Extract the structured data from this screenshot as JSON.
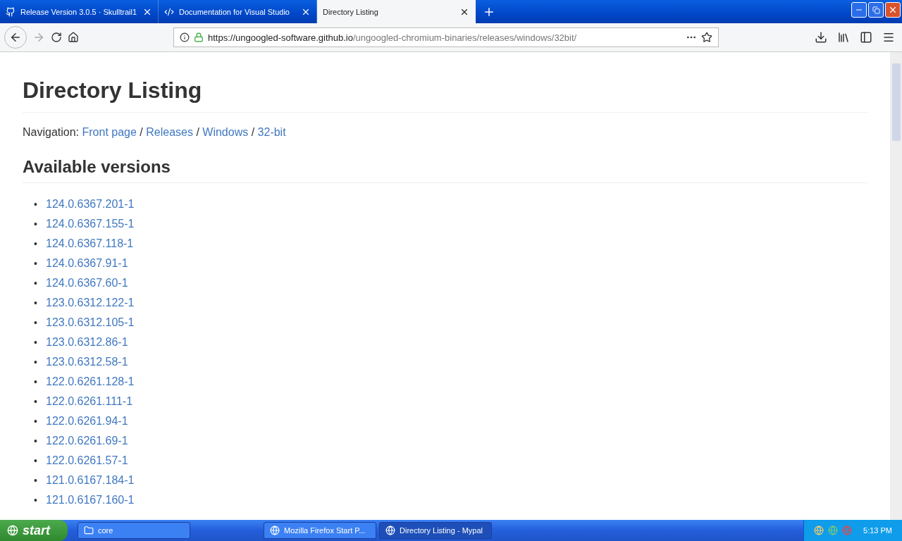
{
  "tabs": [
    {
      "title": "Release Version 3.0.5 · Skulltrail1",
      "selected": false
    },
    {
      "title": "Documentation for Visual Studio",
      "selected": false
    },
    {
      "title": "Directory Listing",
      "selected": true
    }
  ],
  "address_bar": {
    "host": "https://ungoogled-software.github.io",
    "path": "/ungoogled-chromium-binaries/releases/windows/32bit/"
  },
  "page": {
    "title": "Directory Listing",
    "navigation_label": "Navigation:",
    "breadcrumbs": [
      "Front page",
      "Releases",
      "Windows",
      "32-bit"
    ],
    "breadcrumb_separator": "/",
    "section_title": "Available versions",
    "list_marker": "•",
    "versions": [
      "124.0.6367.201-1",
      "124.0.6367.155-1",
      "124.0.6367.118-1",
      "124.0.6367.91-1",
      "124.0.6367.60-1",
      "123.0.6312.122-1",
      "123.0.6312.105-1",
      "123.0.6312.86-1",
      "123.0.6312.58-1",
      "122.0.6261.128-1",
      "122.0.6261.111-1",
      "122.0.6261.94-1",
      "122.0.6261.69-1",
      "122.0.6261.57-1",
      "121.0.6167.184-1",
      "121.0.6167.160-1"
    ]
  },
  "taskbar": {
    "start_label": "start",
    "items": [
      {
        "label": "core",
        "selected": false
      },
      {
        "label": "Mozilla Firefox Start P...",
        "selected": false
      },
      {
        "label": "Directory Listing - Mypal",
        "selected": true
      }
    ],
    "clock": "5:13 PM"
  }
}
